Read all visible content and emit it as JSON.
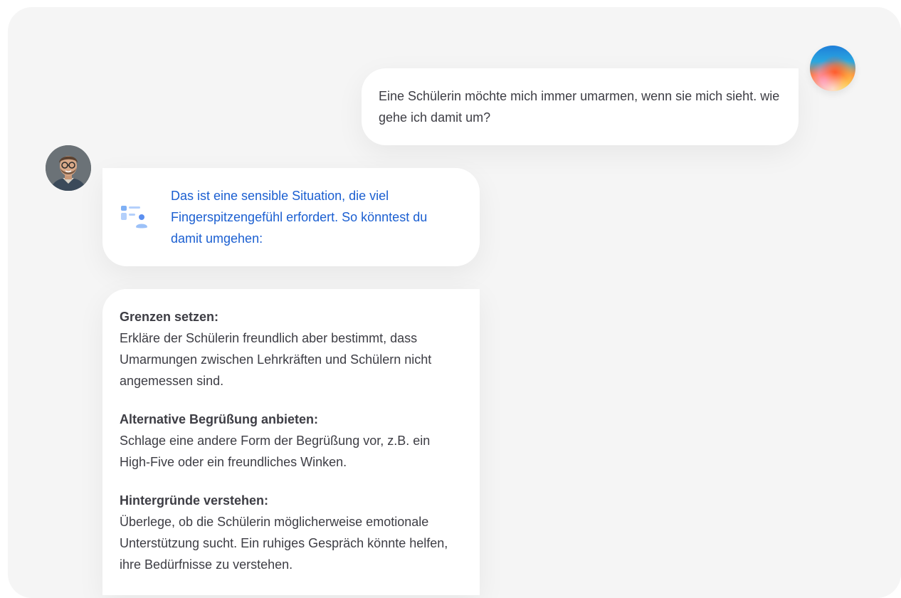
{
  "chat": {
    "question": "Eine Schülerin möchte mich immer umarmen, wenn sie mich sieht. wie gehe ich damit um?",
    "intro": "Das ist eine sensible Situation, die viel Fingerspitzengefühl erfordert. So könntest du damit umgehen:",
    "intro_icon": "person-list-icon",
    "tips": [
      {
        "title": "Grenzen setzen:",
        "text": "Erkläre der Schülerin freundlich aber bestimmt, dass Umarmungen zwischen Lehrkräften und Schülern nicht angemessen sind."
      },
      {
        "title": "Alternative Begrüßung anbieten:",
        "text": "Schlage eine andere Form der Begrüßung vor, z.B. ein High-Five oder ein freundliches Winken."
      },
      {
        "title": "Hintergründe verstehen:",
        "text": "Überlege, ob die Schülerin möglicherweise emotionale Unterstützung sucht. Ein ruhiges Gespräch könnte helfen, ihre Bedürfnisse zu verstehen."
      }
    ]
  },
  "colors": {
    "background": "#f5f5f5",
    "bubble": "#ffffff",
    "text": "#3d3d44",
    "accent_text": "#1b5fd1"
  }
}
